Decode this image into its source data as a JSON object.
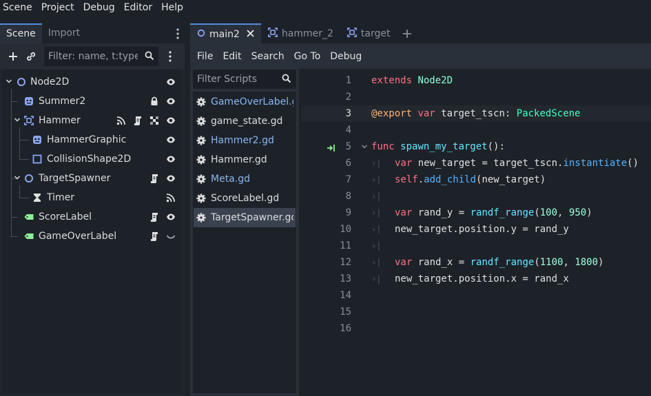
{
  "menubar": {
    "items": [
      "Scene",
      "Project",
      "Debug",
      "Editor",
      "Help"
    ]
  },
  "dock": {
    "tabs": [
      "Scene",
      "Import"
    ],
    "filter_placeholder": "Filter: name, t:type, g:group"
  },
  "scene_tree": [
    {
      "label": "Node2D",
      "icon": "node2d-icon",
      "visible": true
    },
    {
      "label": "Summer2",
      "icon": "sprite-icon",
      "locked": true,
      "visible": true
    },
    {
      "label": "Hammer",
      "icon": "area2d-icon",
      "signals": true,
      "script": true,
      "group": true,
      "visible": true
    },
    {
      "label": "HammerGraphic",
      "icon": "sprite-icon",
      "visible": true
    },
    {
      "label": "CollisionShape2D",
      "icon": "collision-shape-icon",
      "visible": true
    },
    {
      "label": "TargetSpawner",
      "icon": "node2d-icon",
      "script": true,
      "visible": true
    },
    {
      "label": "Timer",
      "icon": "hourglass-icon",
      "signals": true
    },
    {
      "label": "ScoreLabel",
      "icon": "label-icon",
      "script": true,
      "visible": true
    },
    {
      "label": "GameOverLabel",
      "icon": "label-icon",
      "script": true,
      "hidden": true
    }
  ],
  "scene_tabs": [
    {
      "label": "main2",
      "active": true
    },
    {
      "label": "hammer_2",
      "active": false
    },
    {
      "label": "target",
      "active": false
    }
  ],
  "editor_menu": [
    "File",
    "Edit",
    "Search",
    "Go To",
    "Debug"
  ],
  "script_filter_placeholder": "Filter Scripts",
  "scripts": [
    {
      "name": "GameOverLabel.gd",
      "modified": true
    },
    {
      "name": "game_state.gd",
      "modified": false
    },
    {
      "name": "Hammer2.gd",
      "modified": true
    },
    {
      "name": "Hammer.gd",
      "modified": false
    },
    {
      "name": "Meta.gd",
      "modified": true
    },
    {
      "name": "ScoreLabel.gd",
      "modified": false
    },
    {
      "name": "TargetSpawner.gd",
      "modified": false,
      "selected": true
    }
  ],
  "code_lines": [
    {
      "n": "1",
      "text": "extends Node2D"
    },
    {
      "n": "2",
      "text": ""
    },
    {
      "n": "3",
      "text": "@export var target_tscn: PackedScene"
    },
    {
      "n": "4",
      "text": ""
    },
    {
      "n": "5",
      "text": "func spawn_my_target():"
    },
    {
      "n": "6",
      "text": "var new_target = target_tscn.instantiate()"
    },
    {
      "n": "7",
      "text": "self.add_child(new_target)"
    },
    {
      "n": "8",
      "text": ""
    },
    {
      "n": "9",
      "text": "var rand_y = randf_range(100, 950)"
    },
    {
      "n": "10",
      "text": "new_target.position.y = rand_y"
    },
    {
      "n": "11",
      "text": ""
    },
    {
      "n": "12",
      "text": "var rand_x = randf_range(1100, 1800)"
    },
    {
      "n": "13",
      "text": "new_target.position.x = rand_x"
    },
    {
      "n": "14",
      "text": ""
    },
    {
      "n": "15",
      "text": ""
    },
    {
      "n": "16",
      "text": ""
    }
  ],
  "colors": {
    "accent": "#4f8ede",
    "keyword": "#ff7085",
    "type": "#42ffc2",
    "annotation": "#ffb373",
    "function": "#66e6ff",
    "number": "#a1ffe0"
  }
}
